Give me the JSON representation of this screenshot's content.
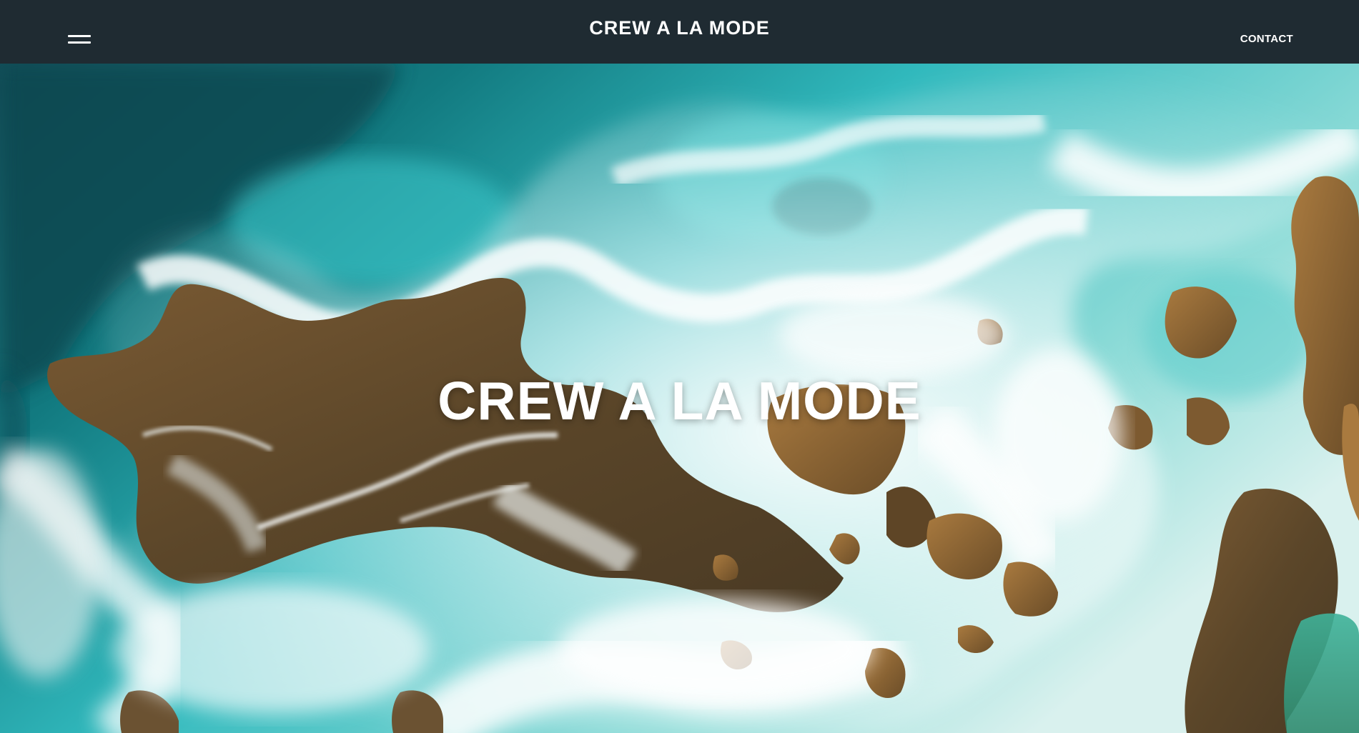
{
  "header": {
    "menu_icon": "hamburger-menu-icon",
    "brand": "CREW A LA MODE",
    "contact_label": "CONTACT"
  },
  "hero": {
    "title": "CREW A LA MODE",
    "background": "aerial view of turquoise ocean waves crashing on brown rocky shore"
  },
  "colors": {
    "header_bg": "#1f2b32",
    "text": "#ffffff",
    "deep_sea": "#0f5e66",
    "turquoise": "#2cc0c4",
    "foam": "#f4f6f4",
    "rock": "#6b5232"
  }
}
